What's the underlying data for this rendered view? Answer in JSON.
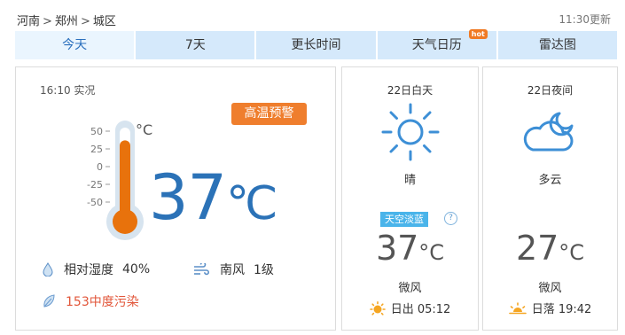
{
  "breadcrumb": {
    "province": "河南",
    "city": "郑州",
    "district": "城区",
    "separator": ">"
  },
  "updated": "11:30更新",
  "tabs": [
    {
      "label": "今天",
      "active": true
    },
    {
      "label": "7天"
    },
    {
      "label": "更长时间"
    },
    {
      "label": "天气日历",
      "badge": "hot"
    },
    {
      "label": "雷达图"
    }
  ],
  "now": {
    "observed": "16:10 实况",
    "alert": "高温预警",
    "thermometer": {
      "unit": "°C",
      "ticks": [
        "50",
        "25",
        "0",
        "-25",
        "-50"
      ],
      "scale_min": -50,
      "scale_max": 50,
      "reading": 37
    },
    "temp": "37",
    "temp_unit": "℃",
    "humidity_label": "相对湿度",
    "humidity_value": "40%",
    "wind_dir": "南风",
    "wind_level": "1级",
    "pollution": "153中度污染"
  },
  "day": {
    "title": "22日白天",
    "icon": "sunny-icon",
    "condition": "晴",
    "aqi_label": "天空淡蓝",
    "help": "?",
    "temp": "37",
    "temp_unit": "°C",
    "wind": "微风",
    "sun_label": "日出 05:12"
  },
  "night": {
    "title": "22日夜间",
    "icon": "cloudy-night-icon",
    "condition": "多云",
    "temp": "27",
    "temp_unit": "°C",
    "wind": "微风",
    "sun_label": "日落 19:42"
  },
  "colors": {
    "tab_bg": "#d5e9fb",
    "tab_active_text": "#2a6fbd",
    "alert": "#ef7e2d",
    "big_temp": "#2b72b7",
    "pollution": "#e2563a",
    "aqi": "#4ab4ea",
    "icon_blue": "#3d8fd6"
  }
}
